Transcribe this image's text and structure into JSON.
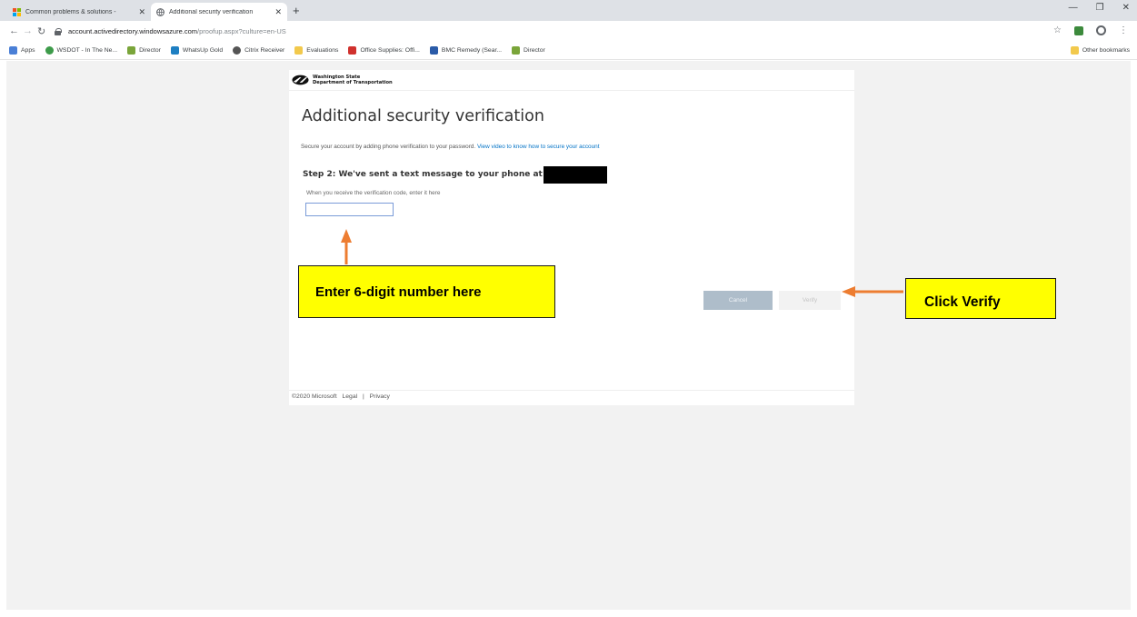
{
  "browser": {
    "tabs": [
      {
        "title": "Common problems & solutions -",
        "active": false,
        "favicon": "windows-grid-icon"
      },
      {
        "title": "Additional security verification",
        "active": true,
        "favicon": "globe-icon"
      }
    ],
    "url_host": "account.activedirectory.windowsazure.com",
    "url_path": "/proofup.aspx?culture=en-US",
    "bookmarks": [
      {
        "label": "Apps",
        "icon": "apps-grid-icon",
        "color": "#4a7fd6"
      },
      {
        "label": "WSDOT - In The Ne...",
        "icon": "globe-icon",
        "color": "#3d9b4a"
      },
      {
        "label": "Director",
        "icon": "director-icon",
        "color": "#7aa53a"
      },
      {
        "label": "WhatsUp Gold",
        "icon": "whatsup-icon",
        "color": "#1e7fc2"
      },
      {
        "label": "Citrix Receiver",
        "icon": "citrix-icon",
        "color": "#555555"
      },
      {
        "label": "Evaluations",
        "icon": "folder-icon",
        "color": "#f2c94c"
      },
      {
        "label": "Office Supplies: Offi...",
        "icon": "office-icon",
        "color": "#d0312d"
      },
      {
        "label": "BMC Remedy (Sear...",
        "icon": "bmc-icon",
        "color": "#2a5ba8"
      },
      {
        "label": "Director",
        "icon": "director-icon",
        "color": "#7aa53a"
      }
    ],
    "other_bookmarks": "Other bookmarks"
  },
  "page": {
    "brand_line1": "Washington State",
    "brand_line2": "Department of Transportation",
    "heading": "Additional security verification",
    "subtitle_text": "Secure your account by adding phone verification to your password.",
    "subtitle_link": "View video to know how to secure your account",
    "step_text": "Step 2: We've sent a text message to your phone at +1",
    "hint": "When you receive the verification code, enter it here",
    "code_value": "",
    "cancel_label": "Cancel",
    "verify_label": "Verify",
    "footer_copyright": "©2020 Microsoft",
    "footer_legal": "Legal",
    "footer_sep": "|",
    "footer_privacy": "Privacy"
  },
  "annotations": {
    "callout_input": "Enter 6-digit number here",
    "callout_verify": "Click Verify",
    "arrow_color": "#ed7d31"
  }
}
